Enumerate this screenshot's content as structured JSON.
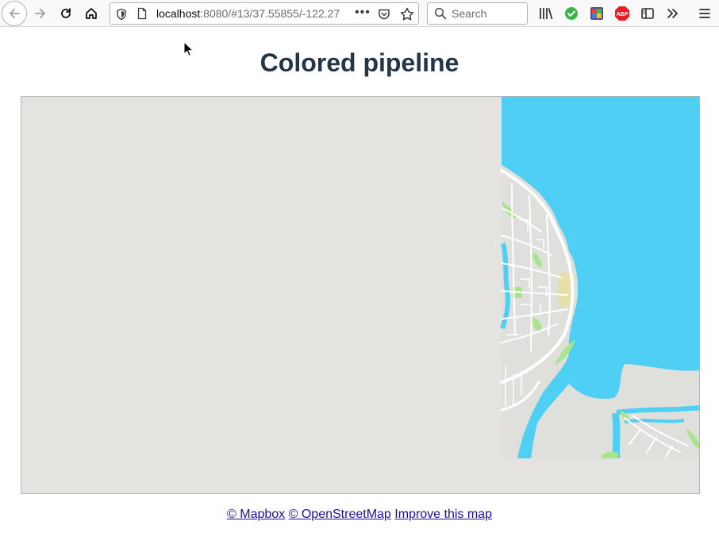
{
  "browser": {
    "url_host": "localhost",
    "url_rest": ":8080/#13/37.55855/-122.27",
    "search_placeholder": "Search"
  },
  "page": {
    "title": "Colored pipeline"
  },
  "map": {
    "center": {
      "zoom": 13,
      "lat": 37.55855,
      "lon": -122.27
    },
    "colors": {
      "background": "#e4e3df",
      "water": "#4fcff4",
      "land": "#dfdfdb",
      "park": "#a6e58c",
      "sand": "#e6dfaa",
      "road": "#ffffff"
    }
  },
  "attribution": {
    "links": [
      "© Mapbox",
      "© OpenStreetMap",
      "Improve this map"
    ]
  }
}
